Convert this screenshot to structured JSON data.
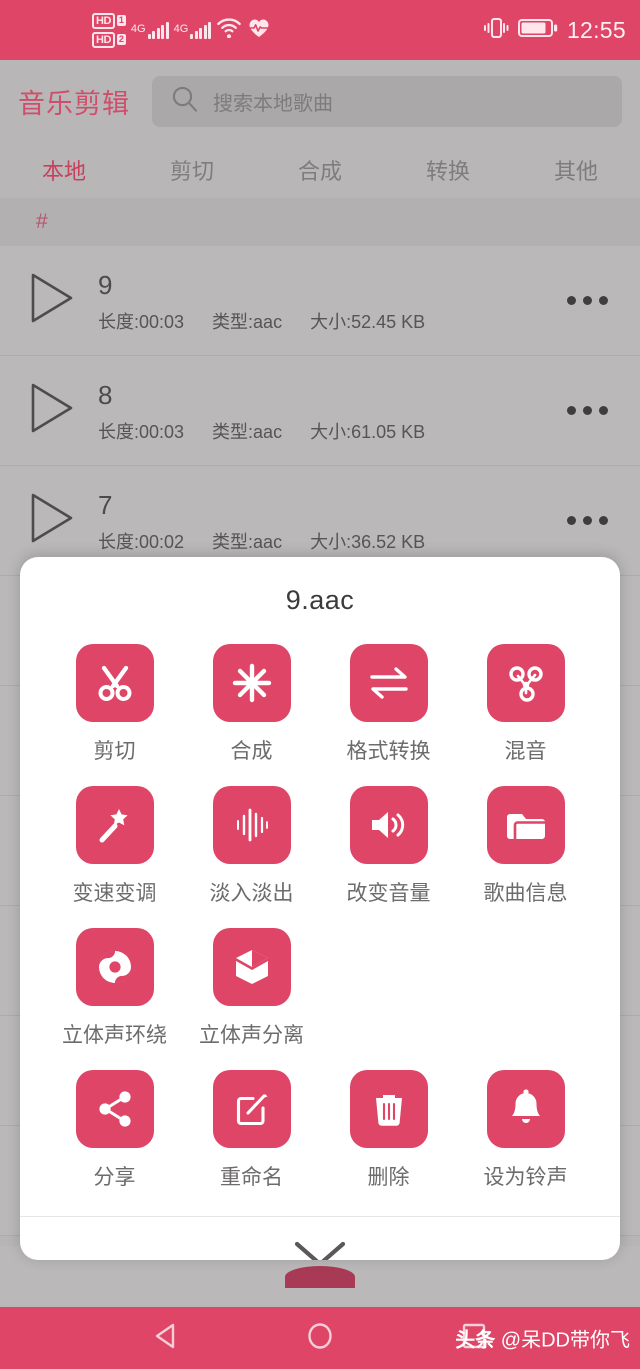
{
  "status_bar": {
    "hd_label_1": "HD",
    "hd_num_1": "1",
    "hd_label_2": "HD",
    "hd_num_2": "2",
    "network_1": "4G",
    "network_2": "4G",
    "wifi_icon": "wifi-icon",
    "health_icon": "heart-pulse-icon",
    "vibrate_icon": "vibrate-icon",
    "battery_icon": "battery-icon",
    "time": "12:55"
  },
  "app_bar": {
    "title": "音乐剪辑",
    "search_icon": "search-icon",
    "search_placeholder": "搜索本地歌曲",
    "search_value": ""
  },
  "tabs": {
    "items": [
      {
        "label": "本地",
        "active": true
      },
      {
        "label": "剪切",
        "active": false
      },
      {
        "label": "合成",
        "active": false
      },
      {
        "label": "转换",
        "active": false
      },
      {
        "label": "其他",
        "active": false
      }
    ]
  },
  "list_header": {
    "label": "#"
  },
  "songs": [
    {
      "name": "9",
      "duration": "长度:00:03",
      "type": "类型:aac",
      "size": "大小:52.45 KB"
    },
    {
      "name": "8",
      "duration": "长度:00:03",
      "type": "类型:aac",
      "size": "大小:61.05 KB"
    },
    {
      "name": "7",
      "duration": "长度:00:02",
      "type": "类型:aac",
      "size": "大小:36.52 KB"
    }
  ],
  "sheet": {
    "title": "9.aac",
    "collapse_icon": "chevron-down-icon",
    "actions": [
      {
        "label": "剪切",
        "icon": "scissors-icon"
      },
      {
        "label": "合成",
        "icon": "asterisk-merge-icon"
      },
      {
        "label": "格式转换",
        "icon": "swap-arrows-icon"
      },
      {
        "label": "混音",
        "icon": "mix-nodes-icon"
      },
      {
        "label": "变速变调",
        "icon": "magic-wand-icon"
      },
      {
        "label": "淡入淡出",
        "icon": "waveform-icon"
      },
      {
        "label": "改变音量",
        "icon": "speaker-volume-icon"
      },
      {
        "label": "歌曲信息",
        "icon": "folder-icon"
      },
      {
        "label": "立体声环绕",
        "icon": "surround-sound-icon"
      },
      {
        "label": "立体声分离",
        "icon": "split-box-icon"
      },
      {
        "label": "分享",
        "icon": "share-icon"
      },
      {
        "label": "重命名",
        "icon": "edit-square-icon"
      },
      {
        "label": "删除",
        "icon": "trash-icon"
      },
      {
        "label": "设为铃声",
        "icon": "bell-icon"
      }
    ]
  },
  "nav_bar": {
    "back_icon": "back-triangle-icon",
    "home_icon": "home-circle-icon",
    "recents_icon": "recents-square-icon"
  },
  "watermark": {
    "brand": "头条",
    "handle": "@呆DD带你飞"
  },
  "colors": {
    "accent": "#de4566",
    "accent_text": "#c7415f",
    "page_bg": "#b7b5b5",
    "row_bg": "#bab8b8",
    "sheet_bg": "#ffffff",
    "label_gray": "#6d6b6b"
  }
}
